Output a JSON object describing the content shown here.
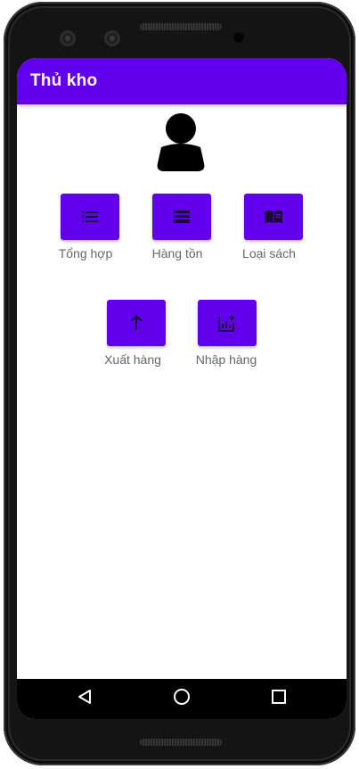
{
  "app_bar": {
    "title": "Thủ kho"
  },
  "profile": {
    "icon": "person-icon"
  },
  "menu": [
    {
      "label": "Tổng hợp",
      "icon": "list-icon"
    },
    {
      "label": "Hàng tồn",
      "icon": "inventory-icon"
    },
    {
      "label": "Loại sách",
      "icon": "book-icon"
    },
    {
      "label": "Xuất hàng",
      "icon": "arrow-up-icon"
    },
    {
      "label": "Nhập hàng",
      "icon": "add-chart-icon"
    }
  ],
  "nav": {
    "icons": [
      "back-icon",
      "home-icon",
      "recents-icon"
    ]
  },
  "colors": {
    "primary": "#6200ee",
    "label": "#666666",
    "background": "#ffffff"
  }
}
